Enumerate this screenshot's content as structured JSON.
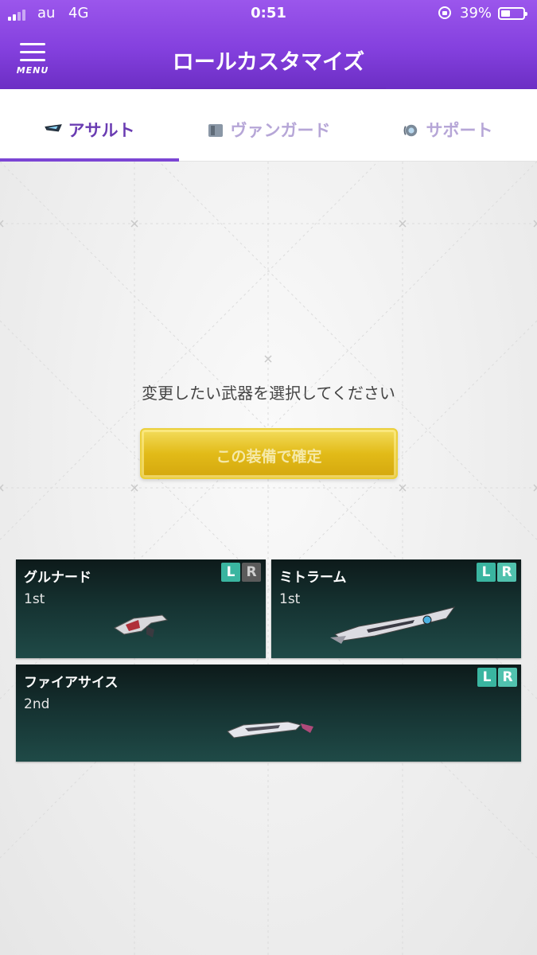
{
  "status_bar": {
    "carrier": "au",
    "network": "4G",
    "time": "0:51",
    "battery": "39%"
  },
  "header": {
    "menu_label": "MENU",
    "title": "ロールカスタマイズ"
  },
  "tabs": [
    {
      "label": "アサルト",
      "active": true
    },
    {
      "label": "ヴァンガード",
      "active": false
    },
    {
      "label": "サポート",
      "active": false
    }
  ],
  "main": {
    "instruction": "変更したい武器を選択してください",
    "confirm_label": "この装備で確定"
  },
  "weapons": [
    {
      "name": "グルナード",
      "rank": "1st",
      "badge_l": "L",
      "badge_r": "R",
      "r_active": false
    },
    {
      "name": "ミトラーム",
      "rank": "1st",
      "badge_l": "L",
      "badge_r": "R",
      "r_active": true
    },
    {
      "name": "ファイアサイス",
      "rank": "2nd",
      "badge_l": "L",
      "badge_r": "R",
      "r_active": true
    }
  ],
  "colors": {
    "header_purple": "#8440de",
    "tab_active": "#6a3cb2",
    "tab_inactive": "#b6a6d7",
    "confirm_gold": "#e2bb18",
    "card_bg": "#163433",
    "badge_teal": "#3ab5a0"
  },
  "icons": {
    "menu": "hamburger-icon",
    "assault_tab": "assault-blade-icon",
    "vanguard_tab": "vanguard-shield-icon",
    "support_tab": "support-orb-icon"
  }
}
